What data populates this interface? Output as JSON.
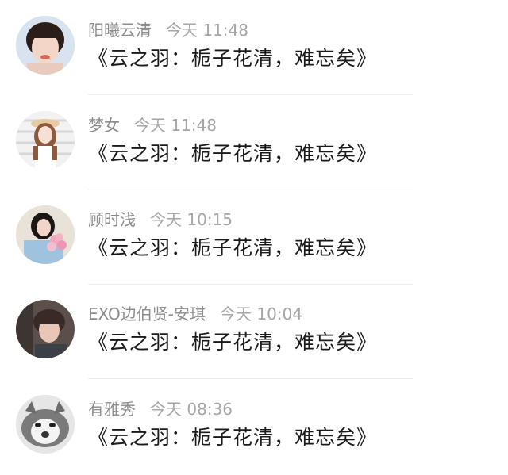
{
  "comments": [
    {
      "user": "阳曦云清",
      "time": "今天 11:48",
      "text": "《云之羽：栀子花清，难忘矣》"
    },
    {
      "user": "梦女",
      "time": "今天 11:48",
      "text": "《云之羽：栀子花清，难忘矣》"
    },
    {
      "user": "顾时浅",
      "time": "今天 10:15",
      "text": "《云之羽：栀子花清，难忘矣》"
    },
    {
      "user": "EXO边伯贤-安琪",
      "time": "今天 10:04",
      "text": "《云之羽：栀子花清，难忘矣》"
    },
    {
      "user": "有雅秀",
      "time": "今天 08:36",
      "text": "《云之羽：栀子花清，难忘矣》"
    }
  ],
  "colors": {
    "username": "#8c8c8c",
    "time": "#a6a6a6",
    "text": "#1a1a1a",
    "divider": "#ececec"
  }
}
